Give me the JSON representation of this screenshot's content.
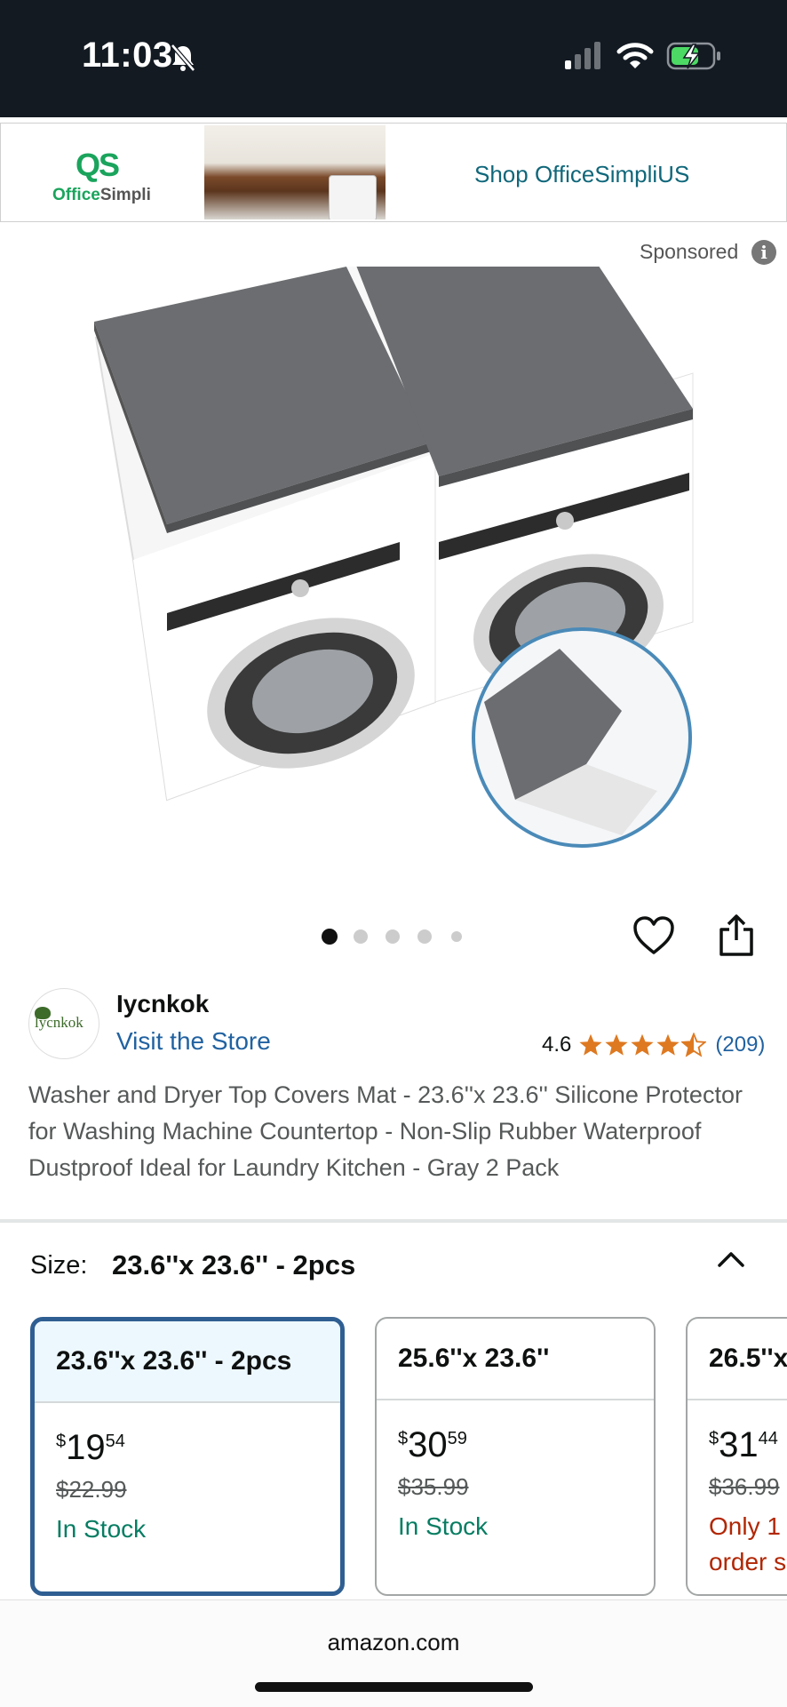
{
  "status_bar": {
    "time": "11:03"
  },
  "ad": {
    "logo_mark": "QS",
    "logo_name_a": "Office",
    "logo_name_b": "Simpli",
    "cta": "Shop OfficeSimpliUS"
  },
  "sponsored_label": "Sponsored",
  "gallery": {
    "image_count": 5,
    "active_index": 0
  },
  "brand": {
    "logo_text": "lycnkok",
    "name": "Iycnkok",
    "visit_store": "Visit the Store"
  },
  "rating": {
    "value": "4.6",
    "stars": 4.5,
    "count": "(209)"
  },
  "product_title": "Washer and Dryer Top Covers Mat - 23.6''x 23.6'' Silicone Protector for Washing Machine Countertop - Non-Slip Rubber Waterproof Dustproof Ideal for Laundry Kitchen - Gray 2 Pack",
  "size": {
    "label": "Size:",
    "selected": "23.6''x 23.6'' - 2pcs"
  },
  "options": [
    {
      "name": "23.6''x 23.6'' - 2pcs",
      "currency": "$",
      "whole": "19",
      "fraction": "54",
      "list_price": "$22.99",
      "availability": "In Stock"
    },
    {
      "name": "25.6''x 23.6''",
      "currency": "$",
      "whole": "30",
      "fraction": "59",
      "list_price": "$35.99",
      "availability": "In Stock"
    },
    {
      "name": "26.5''x",
      "currency": "$",
      "whole": "31",
      "fraction": "44",
      "list_price": "$36.99",
      "availability": "Only 1",
      "availability_2": "order s"
    }
  ],
  "footer": {
    "domain": "amazon.com"
  },
  "colors": {
    "link": "#2162a1",
    "in_stock": "#067d62",
    "low_stock": "#b12704",
    "star": "#de7921",
    "selected_border": "#2f5f92"
  }
}
